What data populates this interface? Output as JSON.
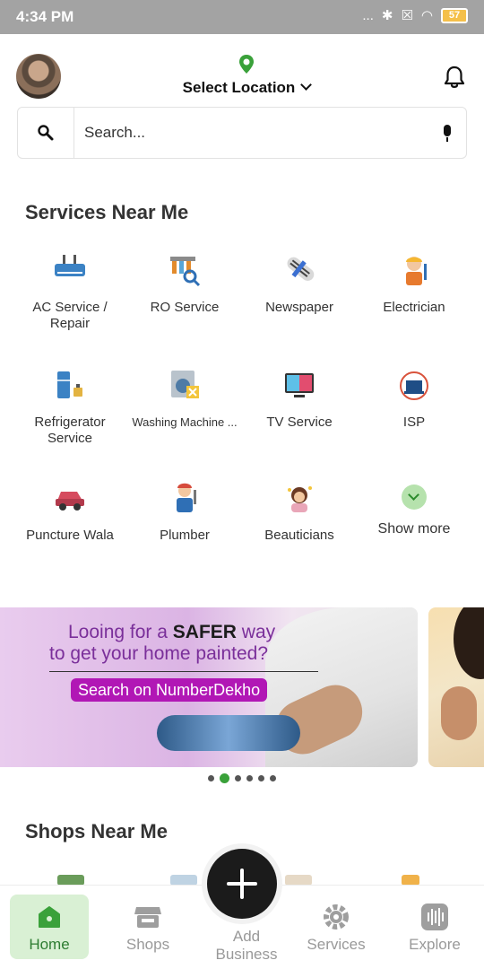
{
  "status_bar": {
    "time": "4:34 PM",
    "signal": "...",
    "battery": "57"
  },
  "header": {
    "location_label": "Select Location",
    "avatar": "user-avatar",
    "notification_icon": "bell-icon"
  },
  "search": {
    "placeholder": "Search..."
  },
  "services": {
    "title": "Services Near Me",
    "items": [
      {
        "label": "AC Service / Repair",
        "icon": "ac-service-icon"
      },
      {
        "label": "RO Service",
        "icon": "ro-service-icon"
      },
      {
        "label": "Newspaper",
        "icon": "newspaper-icon"
      },
      {
        "label": "Electrician",
        "icon": "electrician-icon"
      },
      {
        "label": "Refrigerator Service",
        "icon": "refrigerator-icon"
      },
      {
        "label": "Washing Machine ...",
        "icon": "washing-machine-icon"
      },
      {
        "label": "TV Service",
        "icon": "tv-icon"
      },
      {
        "label": "ISP",
        "icon": "isp-icon"
      },
      {
        "label": "Puncture Wala",
        "icon": "puncture-icon"
      },
      {
        "label": "Plumber",
        "icon": "plumber-icon"
      },
      {
        "label": "Beauticians",
        "icon": "beautician-icon"
      }
    ],
    "show_more": "Show more"
  },
  "banner": {
    "line1_pre": "Looing for a",
    "line1_bold": "SAFER",
    "line1_post": "way",
    "line2": "to get your home painted?",
    "cta": "Search on NumberDekho",
    "active_slide": 2,
    "slide_count": 6
  },
  "shops": {
    "title": "Shops Near Me"
  },
  "bottom_nav": {
    "home": "Home",
    "shops": "Shops",
    "add_business": "Add Business",
    "services": "Services",
    "explore": "Explore"
  },
  "colors": {
    "accent": "#3aa13a",
    "banner_cta": "#b117b5",
    "home_tab_bg": "#d9f0d4"
  }
}
